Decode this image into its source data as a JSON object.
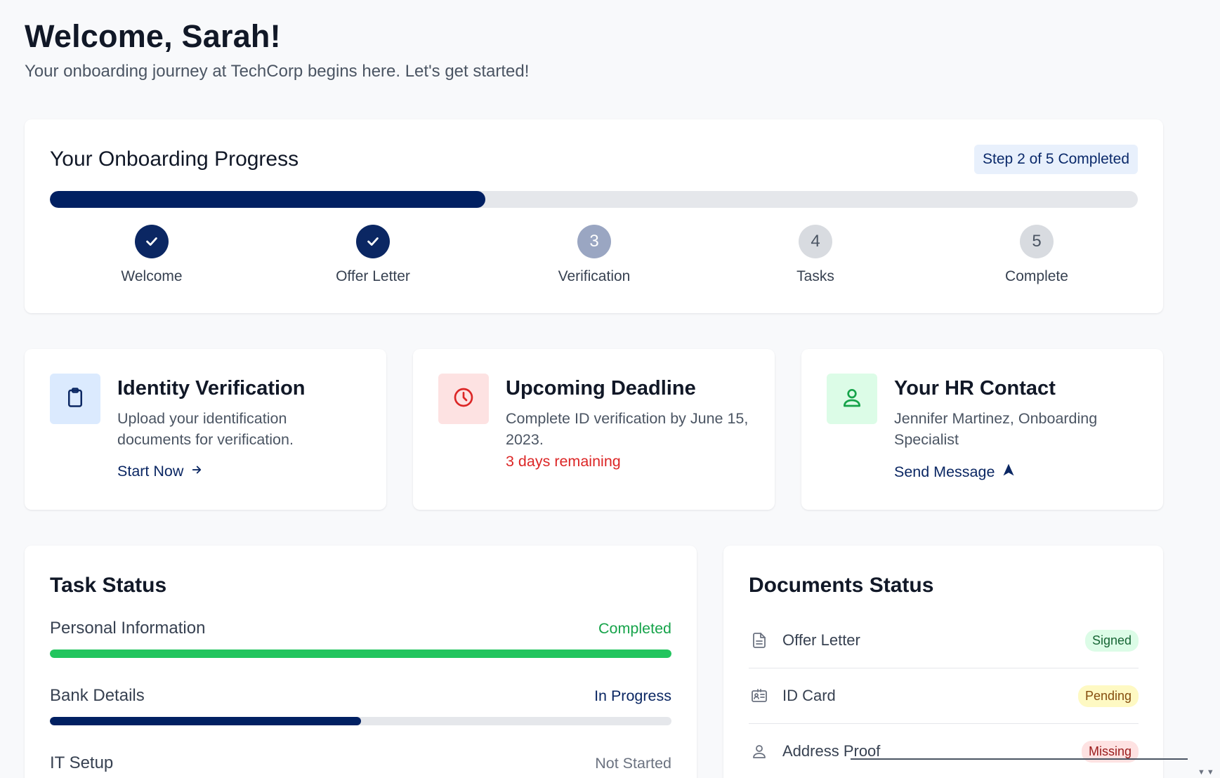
{
  "header": {
    "title": "Welcome, Sarah!",
    "subtitle": "Your onboarding journey at TechCorp begins here. Let's get started!"
  },
  "progress": {
    "title": "Your Onboarding Progress",
    "badge": "Step 2 of 5 Completed",
    "fill_fraction": 0.4,
    "steps": [
      {
        "label": "Welcome",
        "state": "done",
        "number": "1"
      },
      {
        "label": "Offer Letter",
        "state": "done",
        "number": "2"
      },
      {
        "label": "Verification",
        "state": "current",
        "number": "3"
      },
      {
        "label": "Tasks",
        "state": "todo",
        "number": "4"
      },
      {
        "label": "Complete",
        "state": "todo",
        "number": "5"
      }
    ]
  },
  "cards": {
    "identity": {
      "title": "Identity Verification",
      "text": "Upload your identification documents for verification.",
      "link": "Start Now",
      "icon": "clipboard-icon",
      "icon_bg": "#dbeafe",
      "icon_color": "#0b2763"
    },
    "deadline": {
      "title": "Upcoming Deadline",
      "text": "Complete ID verification by June 15, 2023.",
      "alert": "3 days remaining",
      "icon": "clock-icon",
      "icon_bg": "#fde2e2",
      "icon_color": "#dc2626"
    },
    "hr": {
      "title": "Your HR Contact",
      "text": "Jennifer Martinez, Onboarding Specialist",
      "link": "Send Message",
      "icon": "user-icon",
      "icon_bg": "#dcfce7",
      "icon_color": "#16a34a"
    }
  },
  "tasks": {
    "title": "Task Status",
    "items": [
      {
        "name": "Personal Information",
        "status": "Completed",
        "progress": 1.0,
        "status_color": "#16a34a",
        "bar_color": "#22c55e"
      },
      {
        "name": "Bank Details",
        "status": "In Progress",
        "progress": 0.5,
        "status_color": "#0b2763",
        "bar_color": "#012062"
      },
      {
        "name": "IT Setup",
        "status": "Not Started",
        "progress": 0,
        "status_color": "#6b7280",
        "bar_color": "#9ca3af"
      }
    ]
  },
  "documents": {
    "title": "Documents Status",
    "items": [
      {
        "name": "Offer Letter",
        "badge": "Signed",
        "icon": "document-icon",
        "badge_bg": "#dcfce7",
        "badge_color": "#166534"
      },
      {
        "name": "ID Card",
        "badge": "Pending",
        "icon": "id-card-icon",
        "badge_bg": "#fef9c3",
        "badge_color": "#854d0e"
      },
      {
        "name": "Address Proof",
        "badge": "Missing",
        "icon": "user-icon",
        "badge_bg": "#fee2e2",
        "badge_color": "#991b1b"
      }
    ]
  },
  "colors": {
    "primary": "#012062",
    "success": "#22c55e",
    "danger": "#dc2626",
    "background": "#f8f9fb"
  }
}
